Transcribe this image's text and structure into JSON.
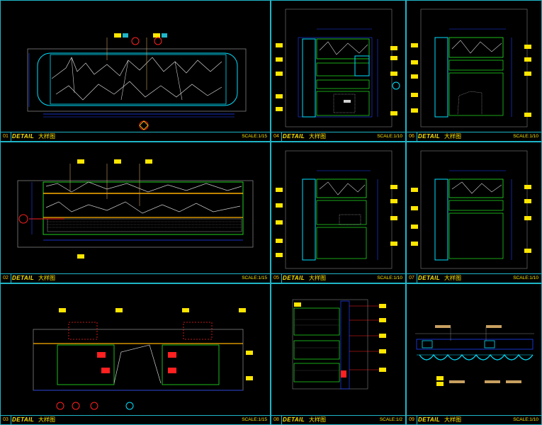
{
  "drawing": {
    "panels": [
      {
        "id": "p01",
        "number": "01",
        "title": "DETAIL",
        "subtitle": "大样图",
        "scale": "SCALE:1/15"
      },
      {
        "id": "p02",
        "number": "02",
        "title": "DETAIL",
        "subtitle": "大样图",
        "scale": "SCALE:1/15"
      },
      {
        "id": "p03",
        "number": "03",
        "title": "DETAIL",
        "subtitle": "大样图",
        "scale": "SCALE:1/15"
      },
      {
        "id": "p04",
        "number": "04",
        "title": "DETAIL",
        "subtitle": "大样图",
        "scale": "SCALE:1/10"
      },
      {
        "id": "p05",
        "number": "05",
        "title": "DETAIL",
        "subtitle": "大样图",
        "scale": "SCALE:1/10"
      },
      {
        "id": "p06",
        "number": "06",
        "title": "DETAIL",
        "subtitle": "大样图",
        "scale": "SCALE:1/10"
      },
      {
        "id": "p07",
        "number": "07",
        "title": "DETAIL",
        "subtitle": "大样图",
        "scale": "SCALE:1/10"
      },
      {
        "id": "p08",
        "number": "08",
        "title": "DETAIL",
        "subtitle": "大样图",
        "scale": "SCALE:1/2"
      },
      {
        "id": "p09",
        "number": "09",
        "title": "DETAIL",
        "subtitle": "大样图",
        "scale": "SCALE:1/10"
      }
    ]
  },
  "colors": {
    "background": "#000000",
    "frame": "#1fb6c8",
    "title_text": "#ffe600",
    "outline": "#808080",
    "marble": "#d0d0d0",
    "structure_green": "#20d020",
    "dimension_blue": "#2040ff",
    "cyan": "#00e0ff",
    "tag_yellow": "#ffe600",
    "tag_orange": "#c8a060",
    "red": "#ff2020"
  }
}
